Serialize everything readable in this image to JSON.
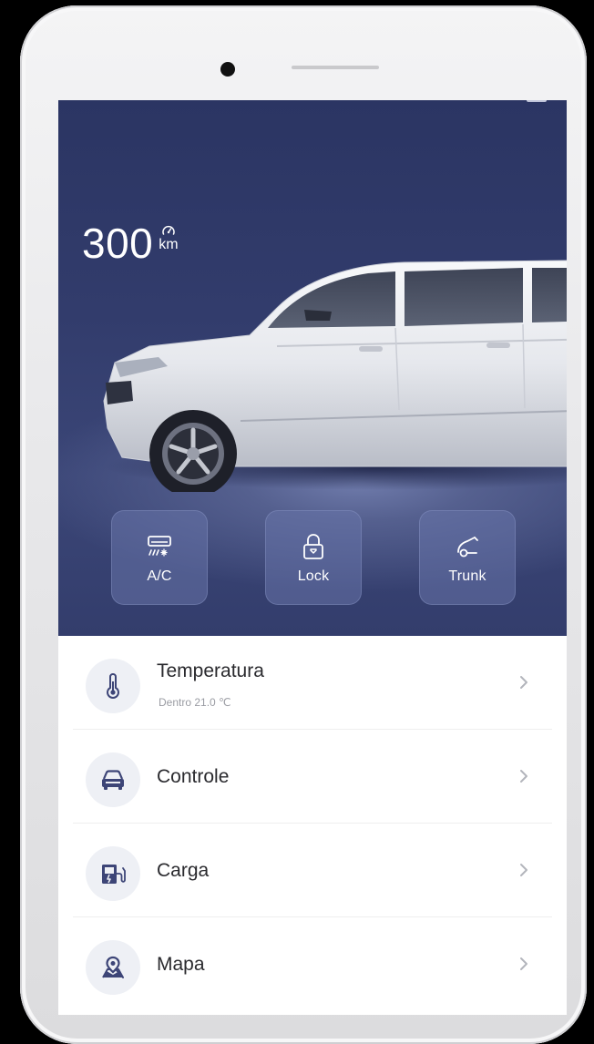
{
  "range": {
    "value": "300",
    "unit": "km",
    "gauge_icon": "speedometer-icon"
  },
  "controls": [
    {
      "label": "A/C",
      "icon": "ac-icon"
    },
    {
      "label": "Lock",
      "icon": "lock-icon"
    },
    {
      "label": "Trunk",
      "icon": "trunk-icon"
    }
  ],
  "menu": [
    {
      "title": "Temperatura",
      "subtitle": "Dentro 21.0 ℃",
      "icon": "thermometer-icon"
    },
    {
      "title": "Controle",
      "icon": "car-icon"
    },
    {
      "title": "Carga",
      "icon": "charging-icon"
    },
    {
      "title": "Mapa",
      "icon": "map-pin-icon"
    }
  ],
  "colors": {
    "hero_background": "#323c6c",
    "button_tile": "#6874aa",
    "icon_circle": "#eef0f5",
    "text_primary": "#2a2a2e",
    "text_secondary": "#9a9ca3"
  }
}
